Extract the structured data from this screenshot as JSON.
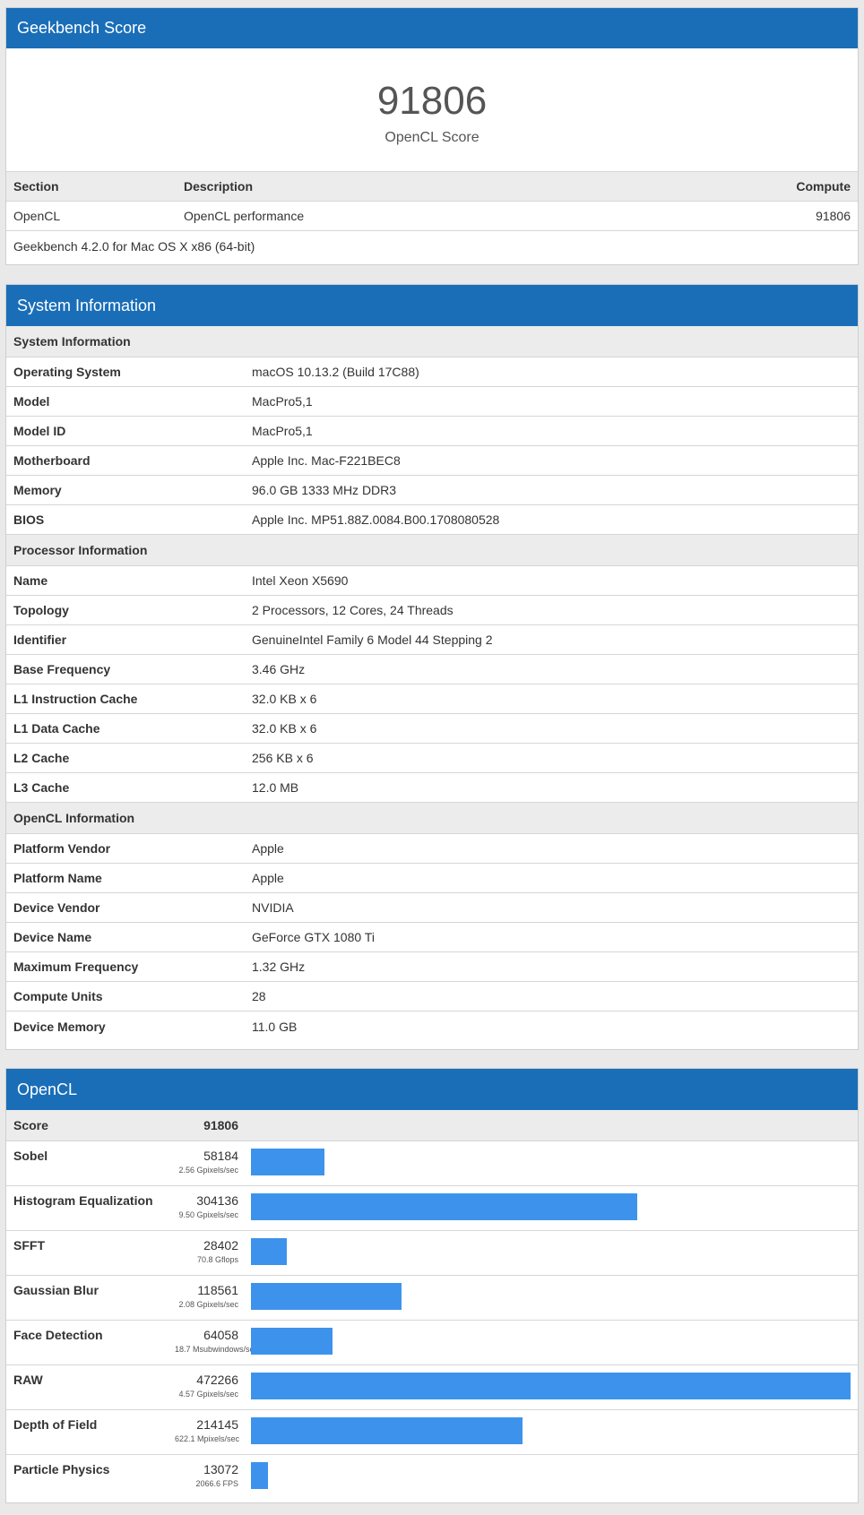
{
  "summary": {
    "header": "Geekbench Score",
    "score": "91806",
    "score_label": "OpenCL Score",
    "columns": {
      "section": "Section",
      "description": "Description",
      "compute": "Compute"
    },
    "row": {
      "section": "OpenCL",
      "description": "OpenCL performance",
      "compute": "91806"
    },
    "footer": "Geekbench 4.2.0 for Mac OS X x86 (64-bit)"
  },
  "system": {
    "header": "System Information",
    "sections": [
      {
        "title": "System Information",
        "rows": [
          {
            "k": "Operating System",
            "v": "macOS 10.13.2 (Build 17C88)"
          },
          {
            "k": "Model",
            "v": "MacPro5,1"
          },
          {
            "k": "Model ID",
            "v": "MacPro5,1"
          },
          {
            "k": "Motherboard",
            "v": "Apple Inc. Mac-F221BEC8"
          },
          {
            "k": "Memory",
            "v": "96.0 GB 1333 MHz DDR3"
          },
          {
            "k": "BIOS",
            "v": "Apple Inc. MP51.88Z.0084.B00.1708080528"
          }
        ]
      },
      {
        "title": "Processor Information",
        "rows": [
          {
            "k": "Name",
            "v": "Intel Xeon X5690"
          },
          {
            "k": "Topology",
            "v": "2 Processors, 12 Cores, 24 Threads"
          },
          {
            "k": "Identifier",
            "v": "GenuineIntel Family 6 Model 44 Stepping 2"
          },
          {
            "k": "Base Frequency",
            "v": "3.46 GHz"
          },
          {
            "k": "L1 Instruction Cache",
            "v": "32.0 KB x 6"
          },
          {
            "k": "L1 Data Cache",
            "v": "32.0 KB x 6"
          },
          {
            "k": "L2 Cache",
            "v": "256 KB x 6"
          },
          {
            "k": "L3 Cache",
            "v": "12.0 MB"
          }
        ]
      },
      {
        "title": "OpenCL Information",
        "rows": [
          {
            "k": "Platform Vendor",
            "v": "Apple"
          },
          {
            "k": "Platform Name",
            "v": "Apple"
          },
          {
            "k": "Device Vendor",
            "v": "NVIDIA"
          },
          {
            "k": "Device Name",
            "v": "GeForce GTX 1080 Ti"
          },
          {
            "k": "Maximum Frequency",
            "v": "1.32 GHz"
          },
          {
            "k": "Compute Units",
            "v": "28"
          },
          {
            "k": "Device Memory",
            "v": "11.0 GB"
          }
        ]
      }
    ]
  },
  "opencl": {
    "header": "OpenCL",
    "score_label": "Score",
    "score": "91806",
    "bar_color": "#3d93ec",
    "benchmarks": [
      {
        "name": "Sobel",
        "score": 58184,
        "unit": "2.56 Gpixels/sec"
      },
      {
        "name": "Histogram Equalization",
        "score": 304136,
        "unit": "9.50 Gpixels/sec"
      },
      {
        "name": "SFFT",
        "score": 28402,
        "unit": "70.8 Gflops"
      },
      {
        "name": "Gaussian Blur",
        "score": 118561,
        "unit": "2.08 Gpixels/sec"
      },
      {
        "name": "Face Detection",
        "score": 64058,
        "unit": "18.7 Msubwindows/sec"
      },
      {
        "name": "RAW",
        "score": 472266,
        "unit": "4.57 Gpixels/sec"
      },
      {
        "name": "Depth of Field",
        "score": 214145,
        "unit": "622.1 Mpixels/sec"
      },
      {
        "name": "Particle Physics",
        "score": 13072,
        "unit": "2066.6 FPS"
      }
    ]
  }
}
